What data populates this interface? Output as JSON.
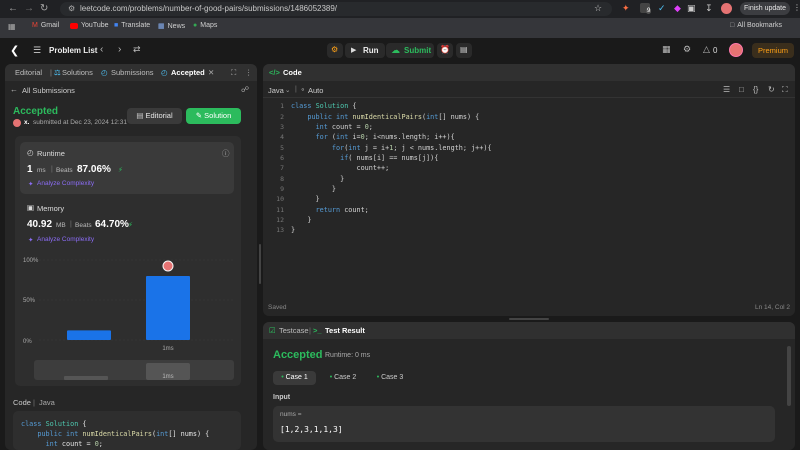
{
  "browser": {
    "url": "leetcode.com/problems/number-of-good-pairs/submissions/1486052389/",
    "finish_update": "Finish update",
    "bookmarks": [
      "Gmail",
      "YouTube",
      "Translate",
      "News",
      "Maps"
    ],
    "all_bookmarks": "All Bookmarks",
    "ext_badge": "9"
  },
  "nav": {
    "problem_list": "Problem List",
    "run": "Run",
    "submit": "Submit",
    "coins": "0",
    "premium": "Premium"
  },
  "left": {
    "tabs": [
      "Editorial",
      "Solutions",
      "Submissions",
      "Accepted"
    ],
    "all_submissions": "All Submissions",
    "status": "Accepted",
    "user": "x.",
    "submitted_at": "submitted at Dec 23, 2024 12:31",
    "editorial_btn": "Editorial",
    "solution_btn": "Solution",
    "runtime": {
      "label": "Runtime",
      "value": "1",
      "unit": "ms",
      "beats_label": "Beats",
      "beats_value": "87.06%",
      "analyze": "Analyze Complexity"
    },
    "memory": {
      "label": "Memory",
      "value": "40.92",
      "unit": "MB",
      "beats_label": "Beats",
      "beats_value": "64.70%",
      "analyze": "Analyze Complexity"
    },
    "chart_labels": {
      "y100": "100%",
      "y50": "50%",
      "y0": "0%",
      "x1": "1ms",
      "x2": "1ms"
    },
    "code_tab": "Code",
    "code_lang": "Java",
    "code_lines": [
      "class Solution {",
      "    public int numIdenticalPairs(int[] nums) {",
      "      int count = 0;"
    ]
  },
  "chart_data": {
    "type": "bar",
    "categories": [
      "",
      "1ms"
    ],
    "values": [
      12,
      80
    ],
    "ylim": [
      0,
      100
    ],
    "yticks": [
      "0%",
      "50%",
      "100%"
    ],
    "highlight_index": 1,
    "colors": {
      "bar": "#1a73e8",
      "grid": "#3a3a3a"
    }
  },
  "editor": {
    "title": "Code",
    "lang": "Java",
    "mode": "Auto",
    "saved": "Saved",
    "cursor": "Ln 14, Col 2",
    "lines": [
      "class Solution {",
      "    public int numIdenticalPairs(int[] nums) {",
      "      int count = 0;",
      "      for (int i=0; i<nums.length; i++){",
      "          for(int j = i+1; j < nums.length; j++){",
      "            if( nums[i] == nums[j]){",
      "                count++;",
      "            }",
      "          }",
      "      }",
      "      return count;",
      "    }",
      "}"
    ]
  },
  "result": {
    "testcase_tab": "Testcase",
    "result_tab": "Test Result",
    "status": "Accepted",
    "runtime": "Runtime: 0 ms",
    "cases": [
      "Case 1",
      "Case 2",
      "Case 3"
    ],
    "input_label": "Input",
    "var_name": "nums =",
    "var_value": "[1,2,3,1,1,3]"
  },
  "colors": {
    "accent_green": "#2cbb5d",
    "accent_orange": "#ffa116",
    "bar_blue": "#1a73e8",
    "purple": "#8b6cf5"
  }
}
